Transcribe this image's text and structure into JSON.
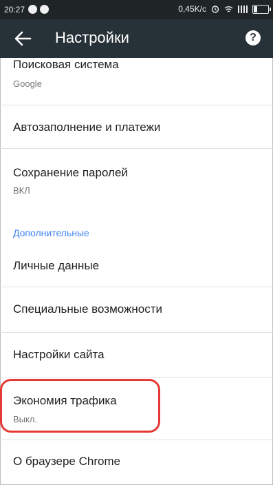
{
  "status_bar": {
    "time": "20:27",
    "speed": "0,45K/c"
  },
  "toolbar": {
    "title": "Настройки",
    "back_icon": "arrow-left-icon",
    "help_icon": "help-circle-icon"
  },
  "settings": {
    "search_engine": {
      "label": "Поисковая система",
      "value": "Google"
    },
    "autofill": {
      "label": "Автозаполнение и платежи"
    },
    "passwords": {
      "label": "Сохранение паролей",
      "value": "ВКЛ"
    },
    "advanced_header": "Дополнительные",
    "privacy": {
      "label": "Личные данные"
    },
    "accessibility": {
      "label": "Специальные возможности"
    },
    "site_settings": {
      "label": "Настройки сайта"
    },
    "data_saver": {
      "label": "Экономия трафика",
      "value": "Выкл."
    },
    "about": {
      "label": "О браузере Chrome"
    }
  },
  "colors": {
    "status_bar_bg": "#1f2426",
    "toolbar_bg": "#273238",
    "accent_blue": "#4285f4",
    "highlight_red": "#e53935"
  }
}
